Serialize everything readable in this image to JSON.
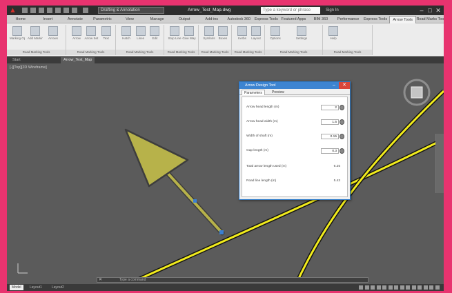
{
  "titlebar": {
    "workspace": "Drafting & Annotation",
    "document": "Arrow_Test_Map.dwg",
    "search_placeholder": "Type a keyword or phrase",
    "signin": "Sign In"
  },
  "ribbon_tabs": [
    "Home",
    "Insert",
    "Annotate",
    "Parametric",
    "View",
    "Manage",
    "Output",
    "Add-ins",
    "Autodesk 360",
    "Express Tools",
    "Featured Apps",
    "BIM 360",
    "Performance",
    "Express Tools",
    "Arrow Tools",
    "Road Marks Tools"
  ],
  "active_ribbon_tab_index": 14,
  "ribbon_panels": [
    {
      "title": "Road Marking Tools",
      "buttons": [
        "Marking Options",
        "Add Marking",
        "Arrows"
      ]
    },
    {
      "title": "Road Marking Tools",
      "buttons": [
        "Arrow",
        "Arrow Set",
        "Text"
      ]
    },
    {
      "title": "Road Marking Tools",
      "buttons": [
        "Hatch",
        "Lines",
        "Edit"
      ]
    },
    {
      "title": "Road Marking Tools",
      "buttons": [
        "Stop Line",
        "Give Way"
      ]
    },
    {
      "title": "Road Marking Tools",
      "buttons": [
        "Symbols",
        "Boxes"
      ]
    },
    {
      "title": "Road Marking Tools",
      "buttons": [
        "Kerbs",
        "Layout"
      ]
    },
    {
      "title": "Road Marking Tools",
      "buttons": [
        "Options",
        "Settings"
      ]
    },
    {
      "title": "Road Marking Tools",
      "buttons": [
        "Help"
      ]
    }
  ],
  "file_tabs": [
    "Start",
    "Arrow_Test_Map"
  ],
  "active_file_tab_index": 1,
  "viewport_label": "[-][Top][2D Wireframe]",
  "dialog": {
    "title": "Arrow Design Tool",
    "tabs": [
      "Parameters",
      "Preview"
    ],
    "active_tab_index": 0,
    "fields": [
      {
        "label": "Arrow head length (m)",
        "value": "2"
      },
      {
        "label": "Arrow head width (m)",
        "value": "1.5"
      },
      {
        "label": "Width of shaft (m)",
        "value": "0.15"
      },
      {
        "label": "Gap length (m)",
        "value": "0.3"
      }
    ],
    "readouts": [
      {
        "label": "Total arrow length used (m)",
        "value": "6.25"
      },
      {
        "label": "Road line length (m)",
        "value": "5.43"
      }
    ]
  },
  "command_line": {
    "close_glyph": "✕",
    "prompt": "Type a command"
  },
  "layout_tabs": [
    "Model",
    "Layout1",
    "Layout2"
  ],
  "active_layout_tab_index": 0,
  "colors": {
    "road_line": "#f2ec1c",
    "road_edge": "#141414",
    "arrow_fill": "#b7b24a",
    "arrow_stroke": "#3d3d3d",
    "background": "#5b5b5b",
    "dialog_title": "#3d84d1",
    "close_red": "#d9453a"
  },
  "icons": {
    "app_logo": "autocad-logo-icon",
    "close": "close-icon",
    "minimize": "minimize-icon"
  }
}
